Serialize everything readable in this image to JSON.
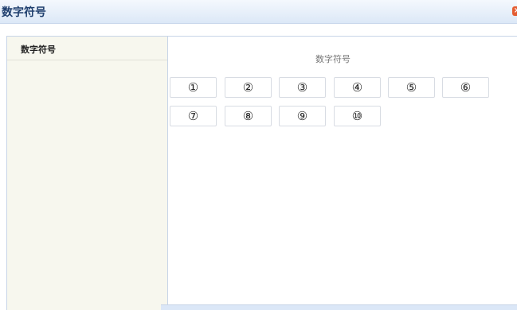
{
  "window": {
    "title": "数字符号",
    "close_icon": "×"
  },
  "sidebar": {
    "items": [
      {
        "label": "数字符号"
      }
    ]
  },
  "content": {
    "heading": "数字符号",
    "symbols": [
      "①",
      "②",
      "③",
      "④",
      "⑤",
      "⑥",
      "⑦",
      "⑧",
      "⑨",
      "⑩"
    ]
  },
  "colors": {
    "title": "#1f3f6e",
    "close": "#e45d32",
    "sidebar_background": "#f7f7ee",
    "border": "#c7d4e7"
  }
}
